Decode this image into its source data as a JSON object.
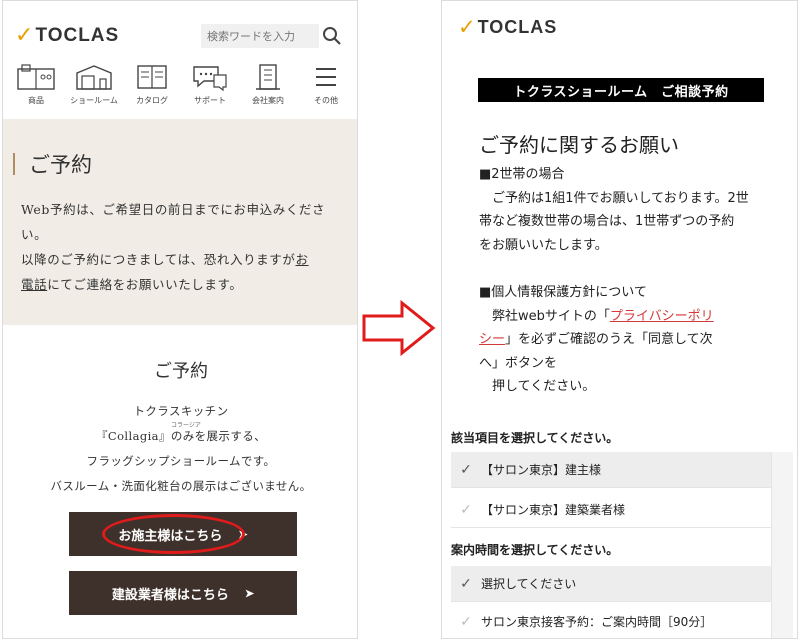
{
  "left": {
    "logo_check": "✓",
    "logo_text": "TOCLAS",
    "search_placeholder": "検索ワードを入力",
    "nav": [
      {
        "label": "商品",
        "icon": "kitchen-icon"
      },
      {
        "label": "ショールーム",
        "icon": "showroom-icon"
      },
      {
        "label": "カタログ",
        "icon": "catalog-icon"
      },
      {
        "label": "サポート",
        "icon": "support-icon"
      },
      {
        "label": "会社案内",
        "icon": "company-icon"
      },
      {
        "label": "その他",
        "icon": "menu-icon"
      }
    ],
    "page_title": "ご予約",
    "info_line1": "Web予約は、ご希望日の前日までにお申込みくださ",
    "info_line2": "い。",
    "info_line3_pre": "以降のご予約につきましては、恐れ入りますが",
    "info_link_part1": "お",
    "info_link_part2": "電話",
    "info_line4_post": "にてご連絡をお願いいたします。",
    "section_title": "ご予約",
    "desc_line1": "トクラスキッチン",
    "desc_ruby": "コラージア",
    "desc_line2": "『Collagia』のみを展示する、",
    "desc_line3": "フラッグシップショールームです。",
    "desc_line4": "バスルーム・洗面化粧台の展示はございません。",
    "owner_button": "お施主様はこちら",
    "builder_button": "建設業者様はこちら",
    "button_arrow": "➤"
  },
  "right": {
    "logo_check": "✓",
    "logo_text": "TOCLAS",
    "banner": "トクラスショールーム　ご相談予約",
    "heading": "ご予約に関するお願い",
    "p1_title": "■2世帯の場合",
    "p1_l1": "　ご予約は1組1件でお願いしております。2世",
    "p1_l2": "帯など複数世帯の場合は、1世帯ずつの予約",
    "p1_l3": "をお願いいたします。",
    "p2_title": "■個人情報保護方針について",
    "p2_l1_pre": "　弊社webサイトの「",
    "p2_link1": "プライバシーポリ",
    "p2_link2": "シー",
    "p2_l2_post": "」を必ずご確認のうえ「同意して次",
    "p2_l3": "へ」ボタンを",
    "p2_l4": "　押してください。",
    "section1_label": "該当項目を選択してください。",
    "options1": [
      "【サロン東京】建主様",
      "【サロン東京】建築業者様"
    ],
    "section2_label": "案内時間を選択してください。",
    "options2": [
      "選択してください",
      "サロン東京接客予約：ご案内時間［90分］"
    ],
    "check_mark": "✓"
  },
  "colors": {
    "accent": "#e8a000",
    "button_bg": "#3e302b",
    "info_bg": "#f1ede6",
    "highlight": "#e01b1b",
    "link_red": "#d43a3a"
  }
}
